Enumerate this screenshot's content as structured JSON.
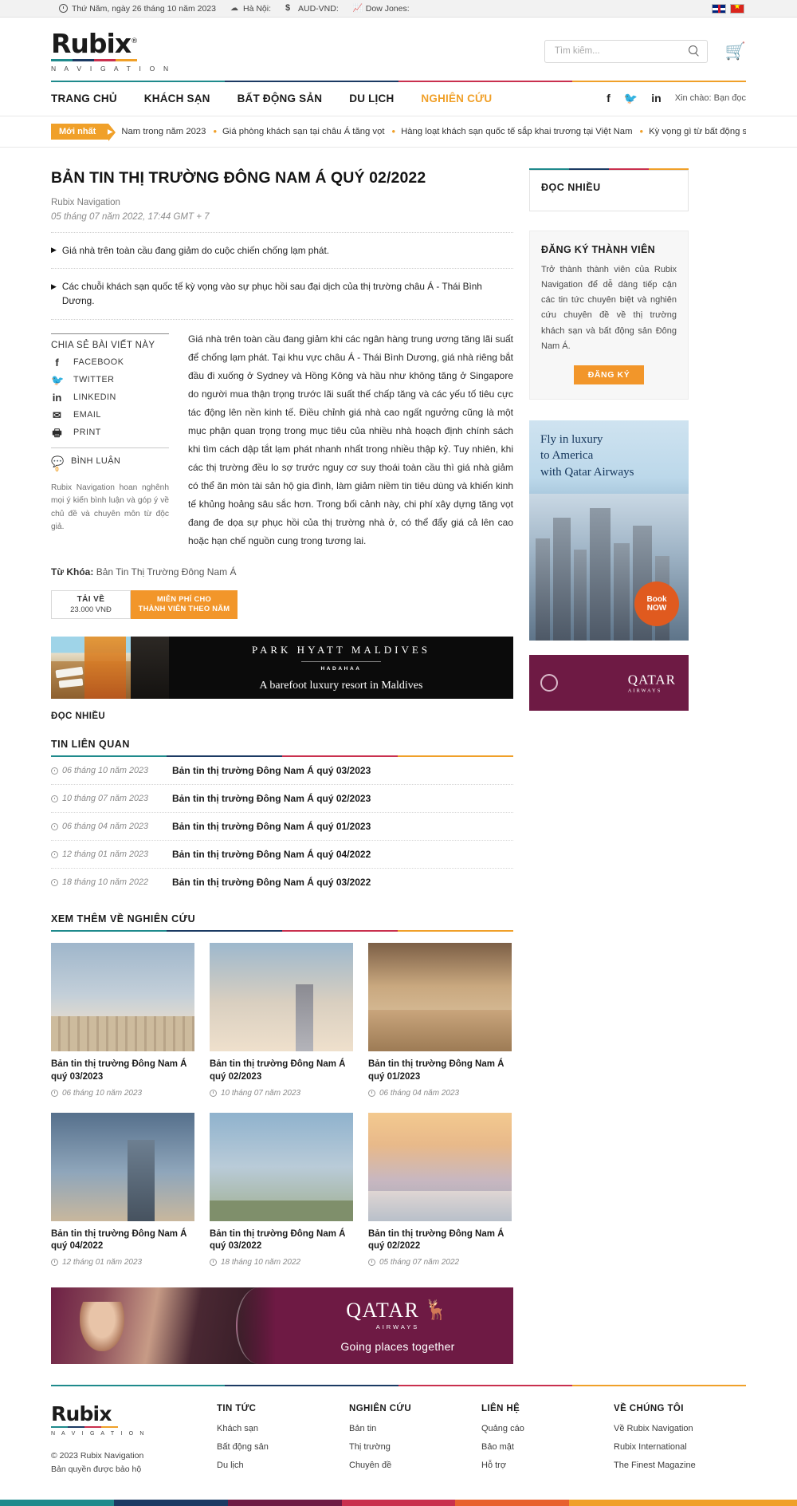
{
  "topbar": {
    "items": [
      {
        "icon": "clock-icon",
        "text": "Thứ Năm, ngày 26 tháng 10 năm 2023"
      },
      {
        "icon": "cloud-icon",
        "text": "Hà Nội:"
      },
      {
        "icon": "dollar-icon",
        "text": "AUD-VND:"
      },
      {
        "icon": "trend-icon",
        "text": "Dow Jones:"
      }
    ],
    "flags": [
      "flag-uk",
      "flag-vn"
    ]
  },
  "header": {
    "logo": "Rubix",
    "logo_tm": "®",
    "logo_sub": "N A V I G A T I O N",
    "search_placeholder": "Tìm kiếm...",
    "search_value": "",
    "cart_icon": "cart-icon"
  },
  "nav": {
    "items": [
      {
        "label": "TRANG CHỦ",
        "active": false
      },
      {
        "label": "KHÁCH SẠN",
        "active": false
      },
      {
        "label": "BẤT ĐỘNG SẢN",
        "active": false
      },
      {
        "label": "DU LỊCH",
        "active": false
      },
      {
        "label": "NGHIÊN CỨU",
        "active": true
      }
    ],
    "social": [
      "f",
      "t",
      "in"
    ],
    "greeting": "Xin chào: Bạn đọc"
  },
  "ticker": {
    "badge": "Mới nhất",
    "items": [
      "Nam trong năm 2023",
      "Giá phòng khách sạn tại châu Á tăng vọt",
      "Hàng loạt khách sạn quốc tế sắp khai trương tại Việt Nam",
      "Kỳ vọng gì từ bất động sản"
    ]
  },
  "article": {
    "title": "BẢN TIN THỊ TRƯỜNG ĐÔNG NAM Á QUÝ 02/2022",
    "author": "Rubix Navigation",
    "date": "05 tháng 07 năm 2022, 17:44 GMT + 7",
    "bullets": [
      "Giá nhà trên toàn cầu đang giảm do cuộc chiến chống lạm phát.",
      "Các chuỗi khách sạn quốc tế kỳ vọng vào sự phục hồi sau đại dịch của thị trường châu Á - Thái Bình Dương."
    ],
    "body": "Giá nhà trên toàn cầu đang giảm khi các ngân hàng trung ương tăng lãi suất để chống lạm phát. Tại khu vực châu Á - Thái Bình Dương, giá nhà riêng bắt đầu đi xuống ở Sydney và Hồng Kông và hầu như không tăng ở Singapore do người mua thận trọng trước lãi suất thế chấp tăng và các yếu tố tiêu cực tác động lên nền kinh tế. Điều chỉnh giá nhà cao ngất ngưởng cũng là một mục phận quan trọng trong mục tiêu của nhiều nhà hoạch định chính sách khi tìm cách dập tắt lạm phát nhanh nhất trong nhiều thập kỷ. Tuy nhiên, khi các thị trường đều lo sợ trước nguy cơ suy thoái toàn cầu thì giá nhà giảm có thể ăn mòn tài sản hộ gia đình, làm giảm niềm tin tiêu dùng và khiến kinh tế khủng hoảng sâu sắc hơn. Trong bối cảnh này, chi phí xây dựng tăng vọt đang đe dọa sự phục hồi của thị trường nhà ở, có thể đẩy giá cả lên cao hoặc hạn chế nguồn cung trong tương lai.",
    "tags_label": "Từ Khóa:",
    "tags_value": "Bản Tin Thị Trường Đông Nam Á",
    "download_title": "TẢI VỀ",
    "download_price": "23.000 VNĐ",
    "free_line1": "MIỄN PHÍ CHO",
    "free_line2": "THÀNH VIÊN THEO NĂM"
  },
  "share": {
    "title": "CHIA SẺ BÀI VIẾT NÀY",
    "items": [
      {
        "icon": "facebook-icon",
        "glyph": "f",
        "label": "FACEBOOK"
      },
      {
        "icon": "twitter-icon",
        "glyph": "🐦",
        "label": "TWITTER"
      },
      {
        "icon": "linkedin-icon",
        "glyph": "in",
        "label": "LINKEDIN"
      },
      {
        "icon": "email-icon",
        "glyph": "✉",
        "label": "EMAIL"
      },
      {
        "icon": "print-icon",
        "glyph": "🖶",
        "label": "PRINT"
      }
    ],
    "comment_icon": "comment-icon",
    "comment_count": "0",
    "comment_title": "BÌNH LUẬN",
    "comment_note": "Rubix Navigation hoan nghênh mọi ý kiến bình luận và góp ý về chủ đề và chuyên môn từ độc giả."
  },
  "ads": {
    "hyatt": {
      "brand": "PARK HYATT MALDIVES",
      "tm": "™",
      "property": "HADAHAA",
      "tagline": "A barefoot luxury resort in Maldives"
    },
    "qatar_tall": {
      "line1": "Fly in luxury",
      "line2": "to America",
      "line3": "with Qatar Airways",
      "cta_line1": "Book",
      "cta_line2": "NOW"
    },
    "qatar_band": {
      "brand": "QATAR",
      "sub": "AIRWAYS"
    },
    "qatar_wide": {
      "brand": "QATAR",
      "sub": "AIRWAYS",
      "tagline": "Going places together"
    }
  },
  "sidebar": {
    "popular_title": "ĐỌC NHIỀU",
    "member": {
      "title": "ĐĂNG KÝ THÀNH VIÊN",
      "body": "Trở thành thành viên của Rubix Navigation để dễ dàng tiếp cận các tin tức chuyên biệt và nghiên cứu chuyên đề về thị trường khách sạn và bất động sản Đông Nam Á.",
      "button": "ĐĂNG KÝ"
    }
  },
  "sections": {
    "popular_label": "ĐỌC NHIỀU",
    "related_title": "TIN LIÊN QUAN",
    "more_title": "XEM THÊM VỀ NGHIÊN CỨU"
  },
  "related": [
    {
      "date": "06 tháng 10 năm 2023",
      "title": "Bản tin thị trường Đông Nam Á quý 03/2023"
    },
    {
      "date": "10 tháng 07 năm 2023",
      "title": "Bản tin thị trường Đông Nam Á quý 02/2023"
    },
    {
      "date": "06 tháng 04 năm 2023",
      "title": "Bản tin thị trường Đông Nam Á quý 01/2023"
    },
    {
      "date": "12 tháng 01 năm 2023",
      "title": "Bản tin thị trường Đông Nam Á quý 04/2022"
    },
    {
      "date": "18 tháng 10 năm 2022",
      "title": "Bản tin thị trường Đông Nam Á quý 03/2022"
    }
  ],
  "cards": [
    {
      "title": "Bản tin thị trường Đông Nam Á quý 03/2023",
      "date": "06 tháng 10 năm 2023"
    },
    {
      "title": "Bản tin thị trường Đông Nam Á quý 02/2023",
      "date": "10 tháng 07 năm 2023"
    },
    {
      "title": "Bản tin thị trường Đông Nam Á quý 01/2023",
      "date": "06 tháng 04 năm 2023"
    },
    {
      "title": "Bản tin thị trường Đông Nam Á quý 04/2022",
      "date": "12 tháng 01 năm 2023"
    },
    {
      "title": "Bản tin thị trường Đông Nam Á quý 03/2022",
      "date": "18 tháng 10 năm 2022"
    },
    {
      "title": "Bản tin thị trường Đông Nam Á quý 02/2022",
      "date": "05 tháng 07 năm 2022"
    }
  ],
  "footer": {
    "logo": "Rubix",
    "logo_sub": "N A V I G A T I O N",
    "copyright": "© 2023 Rubix Navigation",
    "rights": "Bản quyền được bảo hộ",
    "columns": [
      {
        "title": "TIN TỨC",
        "links": [
          "Khách sạn",
          "Bất động sản",
          "Du lịch"
        ]
      },
      {
        "title": "NGHIÊN CỨU",
        "links": [
          "Bản tin",
          "Thị trường",
          "Chuyên đề"
        ]
      },
      {
        "title": "LIÊN HỆ",
        "links": [
          "Quảng cáo",
          "Bảo mật",
          "Hỗ trợ"
        ]
      },
      {
        "title": "VỀ CHÚNG TÔI",
        "links": [
          "Về Rubix Navigation",
          "Rubix International",
          "The Finest Magazine"
        ]
      }
    ]
  },
  "colors": {
    "accent": "#f0a029",
    "teal": "#1f8a8c",
    "navy": "#1b3a63",
    "crimson": "#c9304e",
    "orange": "#f2962a",
    "qatar": "#6e1a44"
  }
}
